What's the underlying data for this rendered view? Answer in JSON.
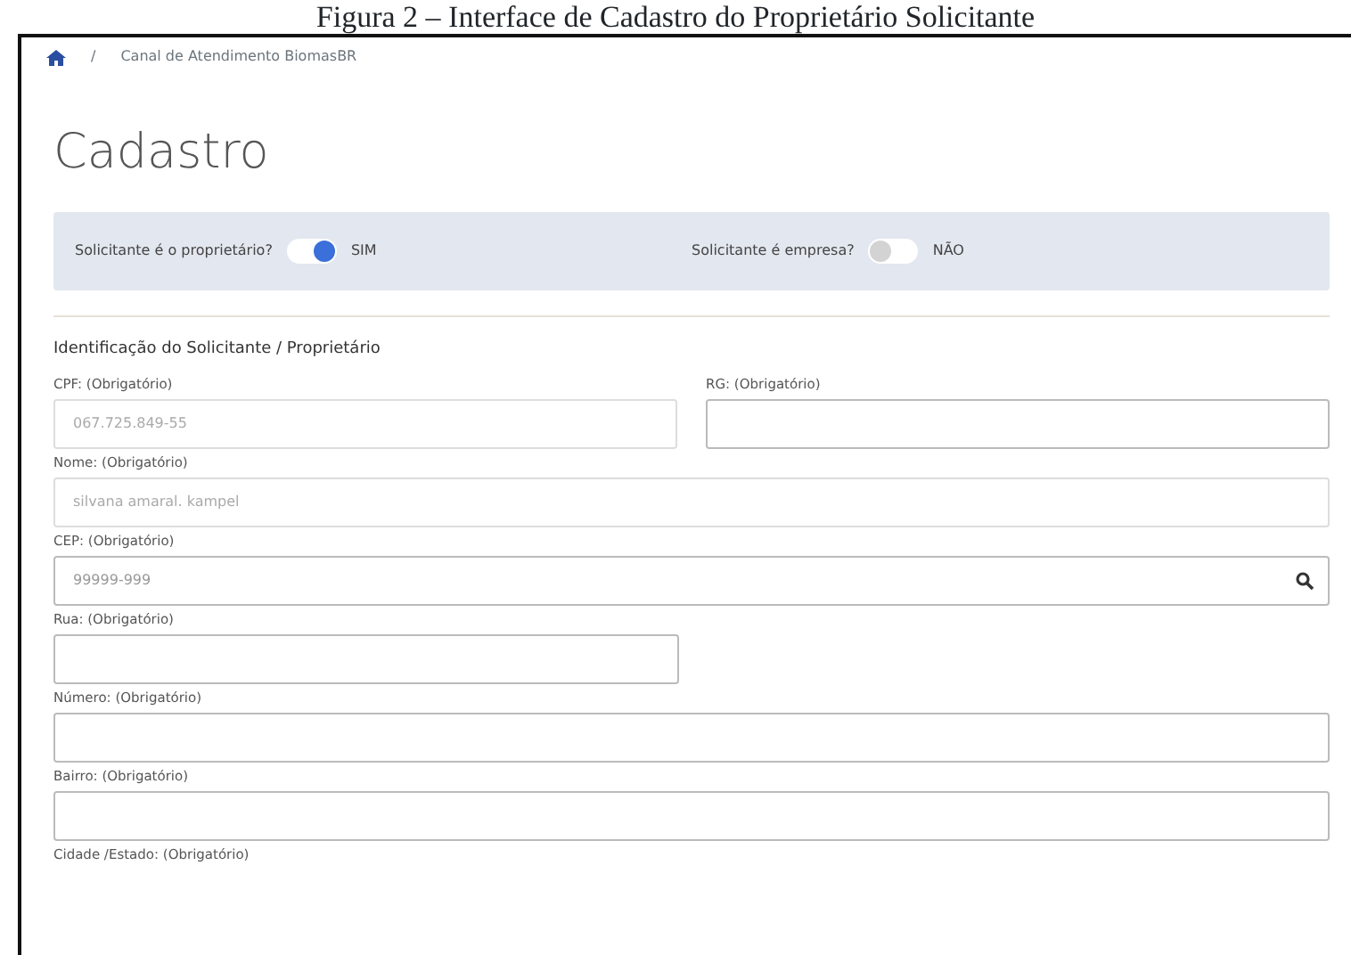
{
  "caption": "Figura 2 – Interface de Cadastro do Proprietário Solicitante",
  "breadcrumb": {
    "separator": "/",
    "current": "Canal de Atendimento BiomasBR"
  },
  "title": "Cadastro",
  "toggles": [
    {
      "label": "Solicitante é o proprietário?",
      "on": true,
      "state_text": "SIM"
    },
    {
      "label": "Solicitante é empresa?",
      "on": false,
      "state_text": "NÃO"
    }
  ],
  "section_title": "Identificação do Solicitante / Proprietário",
  "rows": [
    [
      {
        "label": "CPF: (Obrigatório)",
        "value": "067.725.849-55",
        "disabled": true,
        "kind": "text"
      },
      {
        "label": "RG: (Obrigatório)",
        "disabled": false,
        "kind": "text"
      }
    ],
    [
      {
        "label": "Nome: (Obrigatório)",
        "value": "silvana amaral. kampel",
        "disabled": true,
        "kind": "text"
      }
    ],
    [
      {
        "label": "CEP: (Obrigatório)",
        "placeholder": "99999-999",
        "disabled": false,
        "kind": "search"
      }
    ],
    [
      {
        "label": "Rua: (Obrigatório)",
        "disabled": false,
        "kind": "short-text"
      }
    ],
    [
      {
        "label": "Número: (Obrigatório)",
        "disabled": false,
        "kind": "text"
      }
    ],
    [
      {
        "label": "Bairro: (Obrigatório)",
        "disabled": false,
        "kind": "text"
      }
    ],
    [
      {
        "label": "Cidade /Estado: (Obrigatório)",
        "kind": "label-only"
      }
    ]
  ]
}
